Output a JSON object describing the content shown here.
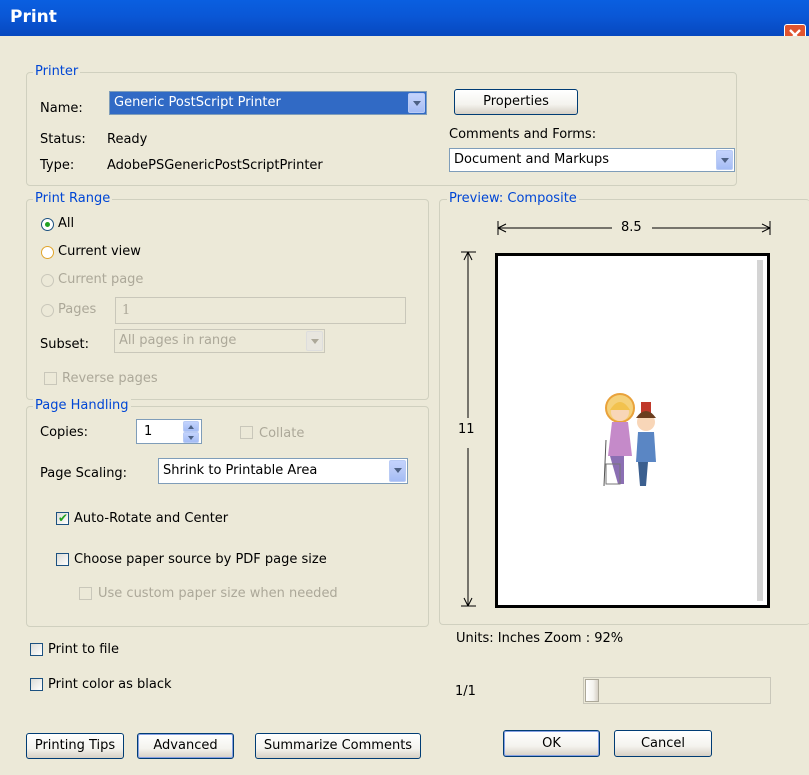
{
  "window": {
    "title": "Print"
  },
  "printer": {
    "legend": "Printer",
    "name_label": "Name:",
    "name_value": "Generic PostScript Printer",
    "status_label": "Status:",
    "status_value": "Ready",
    "type_label": "Type:",
    "type_value": "AdobePSGenericPostScriptPrinter",
    "properties_button": "Properties",
    "comments_label": "Comments and Forms:",
    "comments_value": "Document and Markups"
  },
  "print_range": {
    "legend": "Print Range",
    "all": "All",
    "current_view": "Current view",
    "current_page": "Current page",
    "pages": "Pages",
    "pages_value": "1",
    "subset_label": "Subset:",
    "subset_value": "All pages in range",
    "reverse_pages": "Reverse pages",
    "selected": "all"
  },
  "page_handling": {
    "legend": "Page Handling",
    "copies_label": "Copies:",
    "copies_value": "1",
    "collate": "Collate",
    "scaling_label": "Page Scaling:",
    "scaling_value": "Shrink to Printable Area",
    "auto_rotate": "Auto-Rotate and Center",
    "auto_rotate_checked": true,
    "paper_source": "Choose paper source by PDF page size",
    "custom_paper": "Use custom paper size when needed"
  },
  "options": {
    "print_to_file": "Print to file",
    "print_color_black": "Print color as black"
  },
  "preview": {
    "legend": "Preview: Composite",
    "width": "8.5",
    "height": "11",
    "units_zoom": "Units: Inches Zoom : 92%",
    "page_counter": "1/1",
    "slider_position": 0
  },
  "buttons": {
    "printing_tips": "Printing Tips",
    "advanced": "Advanced",
    "summarize": "Summarize Comments",
    "ok": "OK",
    "cancel": "Cancel"
  },
  "colors": {
    "title_bar": "#0a57d6",
    "legend_text": "#0046d5",
    "check_green": "#21a121",
    "dialog_bg": "#ece9d8"
  }
}
